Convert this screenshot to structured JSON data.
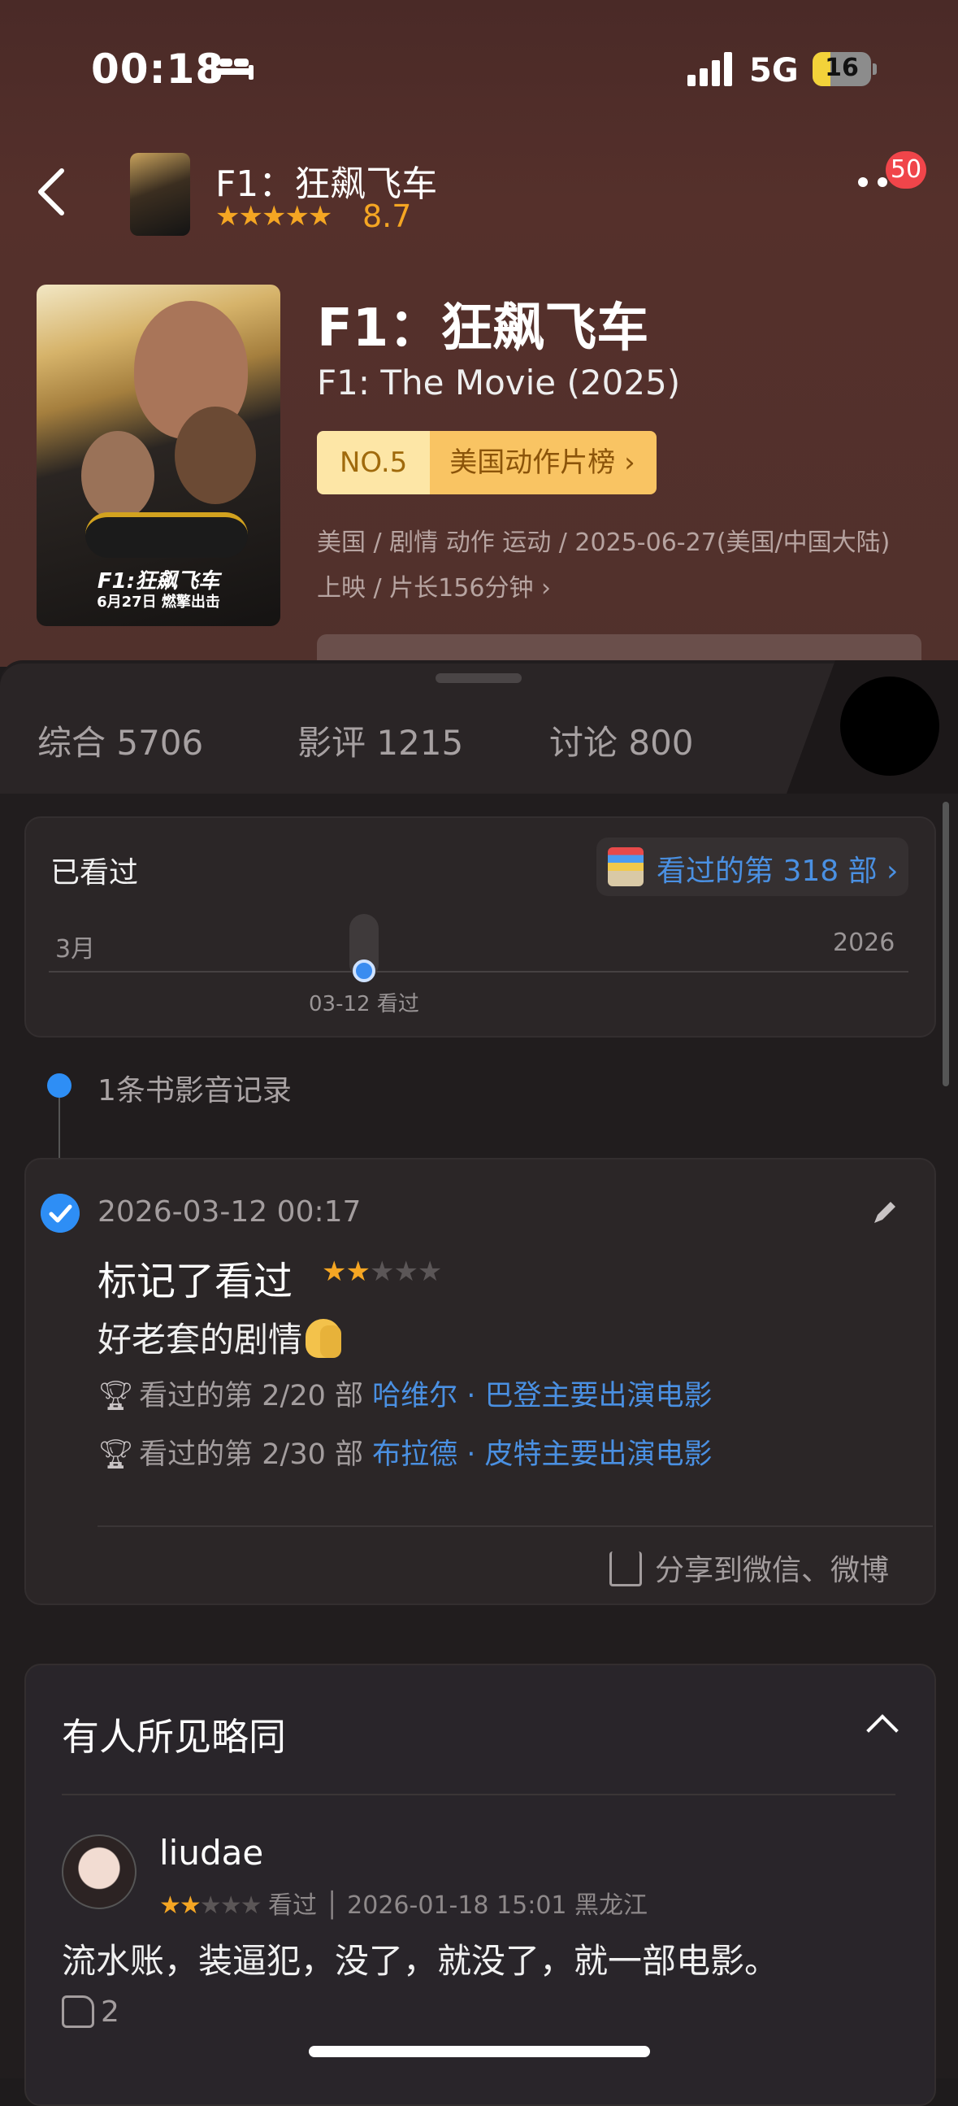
{
  "status": {
    "time": "00:18",
    "network": "5G",
    "battery": "16"
  },
  "nav": {
    "title": "F1：狂飙飞车",
    "stars": "★★★★★",
    "score": "8.7",
    "badge": "50"
  },
  "movie": {
    "title": "F1：狂飙飞车",
    "en_title": "F1: The Movie (2025)",
    "rank_no": "NO.5",
    "rank_list": "美国动作片榜 ›",
    "meta": "美国 / 剧情 动作 运动 / 2025-06-27(美国/中国大陆) 上映 / 片长156分钟 ›",
    "poster_title": "F1:狂飙飞车",
    "poster_sub": "6月27日 燃擎出击"
  },
  "tabs": [
    "综合 5706",
    "影评 1215",
    "讨论 800"
  ],
  "watched": {
    "label": "已看过",
    "count_label": "看过的第 318 部 ›",
    "timeline_start": "3月",
    "timeline_end": "2026",
    "marker_caption": "03-12 看过"
  },
  "records": {
    "summary": "1条书影音记录"
  },
  "record": {
    "datetime": "2026-03-12 00:17",
    "action": "标记了看过",
    "rating_on": "★★",
    "rating_off": "★★★",
    "comment": "好老套的剧情",
    "achievements": [
      {
        "text": "看过的第 2/20 部 ",
        "link": "哈维尔 · 巴登主要出演电影"
      },
      {
        "text": "看过的第 2/30 部 ",
        "link": "布拉德 · 皮特主要出演电影"
      }
    ],
    "share": "分享到微信、微博"
  },
  "similar": {
    "title": "有人所见略同",
    "user": "liudae",
    "rating_on": "★★",
    "rating_off": "★★★",
    "meta": " 看过 │ 2026-01-18 15:01 黑龙江",
    "text": "流水账，装逼犯，没了，就没了，就一部电影。",
    "likes": "2"
  },
  "colors": {
    "accent": "#4a90e2",
    "star": "#f5a623",
    "badge": "#f0454a",
    "header_bg": "#51312c",
    "sheet_bg": "#211d1e"
  }
}
